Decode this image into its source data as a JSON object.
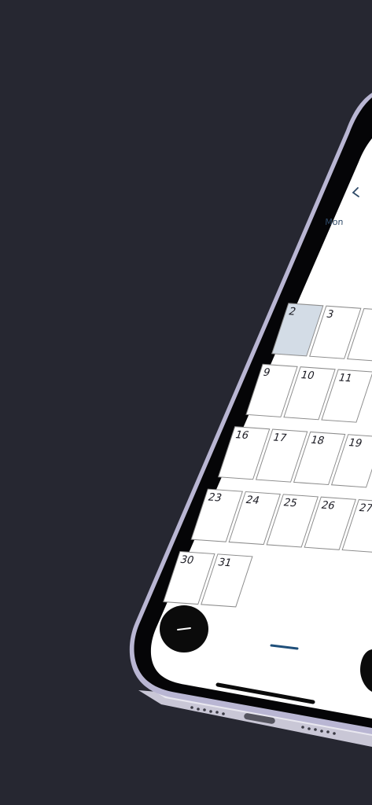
{
  "calendar": {
    "nav": {
      "prev_icon": "chevron-left-icon"
    },
    "weekday_first": "Mon",
    "selected_day": "2",
    "weeks": [
      [
        "2",
        "3"
      ],
      [
        "9",
        "10",
        "11"
      ],
      [
        "16",
        "17",
        "18",
        "19"
      ],
      [
        "23",
        "24",
        "25",
        "26",
        "27"
      ],
      [
        "30",
        "31"
      ]
    ],
    "colors": {
      "selected_fill": "#d3dce6",
      "cell_border": "#8c8c8c",
      "accent": "#1f4f7a",
      "fab": "#0b0b0b"
    }
  },
  "bottom": {
    "fab_left_icon": "minus-icon",
    "page_indicator_icon": "dash-icon"
  }
}
